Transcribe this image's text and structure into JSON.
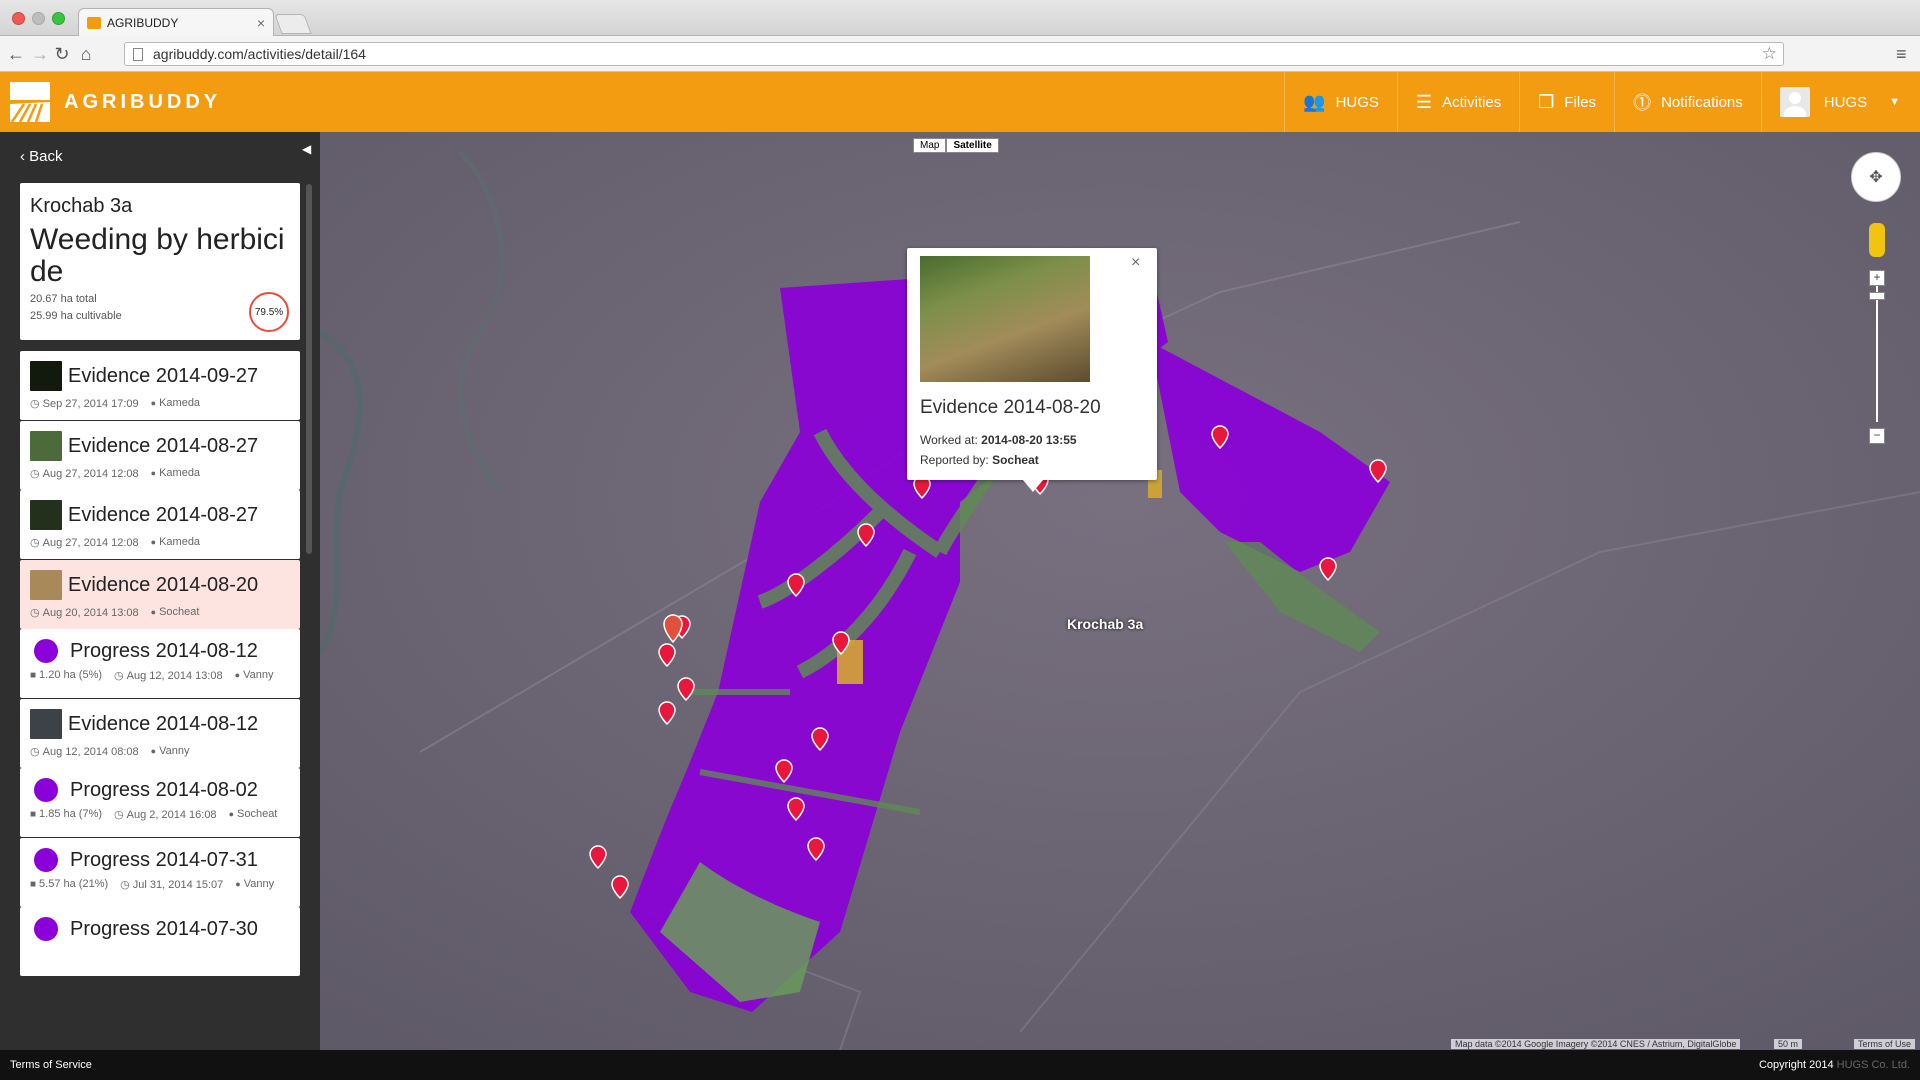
{
  "browser": {
    "tab_title": "AGRIBUDDY",
    "url": "agribuddy.com/activities/detail/164"
  },
  "app": {
    "logo": "AGRIBUDDY",
    "nav": [
      {
        "label": "HUGS",
        "icon": "users-icon"
      },
      {
        "label": "Activities",
        "icon": "list-icon"
      },
      {
        "label": "Files",
        "icon": "files-icon"
      },
      {
        "label": "Notifications",
        "icon": "alert-icon"
      },
      {
        "label": "HUGS",
        "icon": "avatar"
      }
    ],
    "accent_color": "#f39c12"
  },
  "sidebar": {
    "back_label": "Back",
    "summary": {
      "field": "Krochab 3a",
      "activity": "Weeding by herbici de",
      "total": "20.67 ha total",
      "cultivable": "25.99 ha cultivable",
      "progress": "79.5%"
    },
    "entries": [
      {
        "type": "evidence",
        "title": "Evidence 2014-09-27",
        "time": "Sep 27, 2014 17:09",
        "user": "Kameda",
        "thumb": "#111a0d"
      },
      {
        "type": "evidence",
        "title": "Evidence 2014-08-27",
        "time": "Aug 27, 2014 12:08",
        "user": "Kameda",
        "thumb": "#4d6a3b"
      },
      {
        "type": "evidence",
        "title": "Evidence 2014-08-27",
        "time": "Aug 27, 2014 12:08",
        "user": "Kameda",
        "thumb": "#23301c"
      },
      {
        "type": "evidence",
        "title": "Evidence 2014-08-20",
        "time": "Aug 20, 2014 13:08",
        "user": "Socheat",
        "thumb": "#a8895a",
        "active": true
      },
      {
        "type": "progress",
        "title": "Progress 2014-08-12",
        "area": "1.20 ha (5%)",
        "time": "Aug 12, 2014 13:08",
        "user": "Vanny"
      },
      {
        "type": "evidence",
        "title": "Evidence 2014-08-12",
        "time": "Aug 12, 2014 08:08",
        "user": "Vanny",
        "thumb": "#3c4248"
      },
      {
        "type": "progress",
        "title": "Progress 2014-08-02",
        "area": "1.85 ha (7%)",
        "time": "Aug 2, 2014 16:08",
        "user": "Socheat"
      },
      {
        "type": "progress",
        "title": "Progress 2014-07-31",
        "area": "5.57 ha (21%)",
        "time": "Jul 31, 2014 15:07",
        "user": "Vanny"
      },
      {
        "type": "progress",
        "title": "Progress 2014-07-30"
      }
    ]
  },
  "map": {
    "type_map": "Map",
    "type_satellite": "Satellite",
    "field_label": "Krochab 3a",
    "popup": {
      "title": "Evidence 2014-08-20",
      "worked_label": "Worked at:",
      "worked_value": "2014-08-20 13:55",
      "reported_label": "Reported by:",
      "reported_value": "Socheat"
    },
    "attribution": "Map data ©2014 Google Imagery ©2014 CNES / Astrium, DigitalGlobe",
    "scale": "50 m",
    "terms": "Terms of Use",
    "field_color": "#8b00d8"
  },
  "footer": {
    "terms": "Terms of Service",
    "copyright": "Copyright 2014",
    "company": "HUGS Co. Ltd."
  }
}
